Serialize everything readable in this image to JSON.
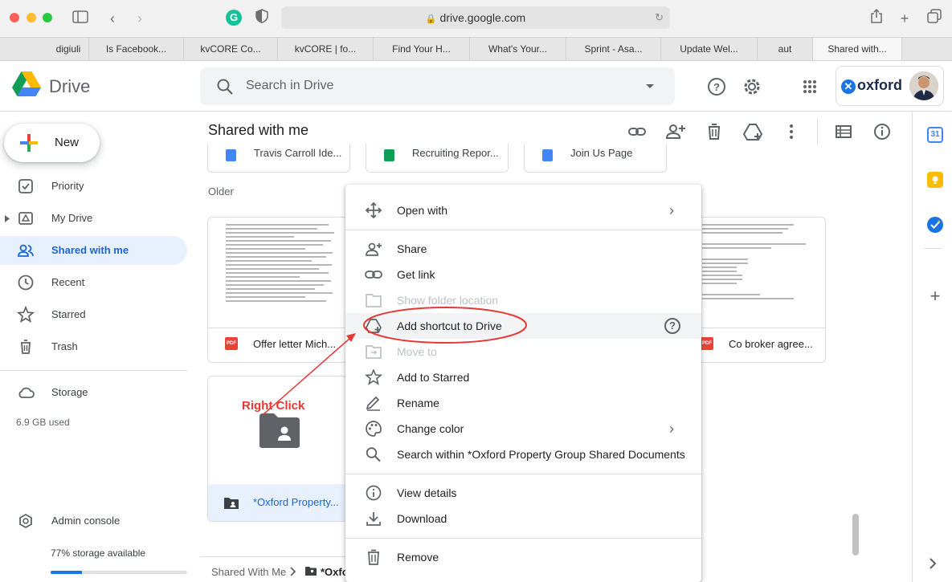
{
  "browser": {
    "url": "drive.google.com",
    "tabs": [
      {
        "label": "digiuli"
      },
      {
        "label": "Is Facebook..."
      },
      {
        "label": "kvCORE Co..."
      },
      {
        "label": "kvCORE | fo..."
      },
      {
        "label": "Find Your H..."
      },
      {
        "label": "What's Your..."
      },
      {
        "label": "Sprint - Asa..."
      },
      {
        "label": "Update Wel..."
      },
      {
        "label": "aut"
      },
      {
        "label": "Shared with..."
      }
    ]
  },
  "header": {
    "app_name": "Drive",
    "search_placeholder": "Search in Drive",
    "account_brand": "oxford"
  },
  "sidebar": {
    "new_label": "New",
    "items": [
      {
        "label": "Priority"
      },
      {
        "label": "My Drive"
      },
      {
        "label": "Shared with me"
      },
      {
        "label": "Recent"
      },
      {
        "label": "Starred"
      },
      {
        "label": "Trash"
      },
      {
        "label": "Storage"
      },
      {
        "label": "Admin console"
      }
    ],
    "storage_used": "6.9 GB used",
    "storage_available": "77% storage available",
    "storage_fraction": 0.23
  },
  "main": {
    "title": "Shared with me",
    "section_older": "Older",
    "top_files": [
      {
        "name": "Travis Carroll Ide..."
      },
      {
        "name": "Recruiting Repor..."
      },
      {
        "name": "Join Us Page"
      }
    ],
    "files": [
      {
        "name": "Offer letter Mich..."
      },
      {
        "name": "Co broker agree..."
      }
    ],
    "folder": {
      "name": "*Oxford Property..."
    },
    "breadcrumb": {
      "root": "Shared With Me",
      "current": "*Oxfo"
    }
  },
  "annotation": {
    "label": "Right Click"
  },
  "context_menu": {
    "open_with": "Open with",
    "share": "Share",
    "get_link": "Get link",
    "show_folder_location": "Show folder location",
    "add_shortcut": "Add shortcut to Drive",
    "move_to": "Move to",
    "add_to_starred": "Add to Starred",
    "rename": "Rename",
    "change_color": "Change color",
    "search_within": "Search within *Oxford Property Group Shared Documents",
    "view_details": "View details",
    "download": "Download",
    "remove": "Remove"
  },
  "colors": {
    "accent": "#1a73e8",
    "active_bg": "#e8f0fe",
    "annotation_red": "#e53935"
  }
}
